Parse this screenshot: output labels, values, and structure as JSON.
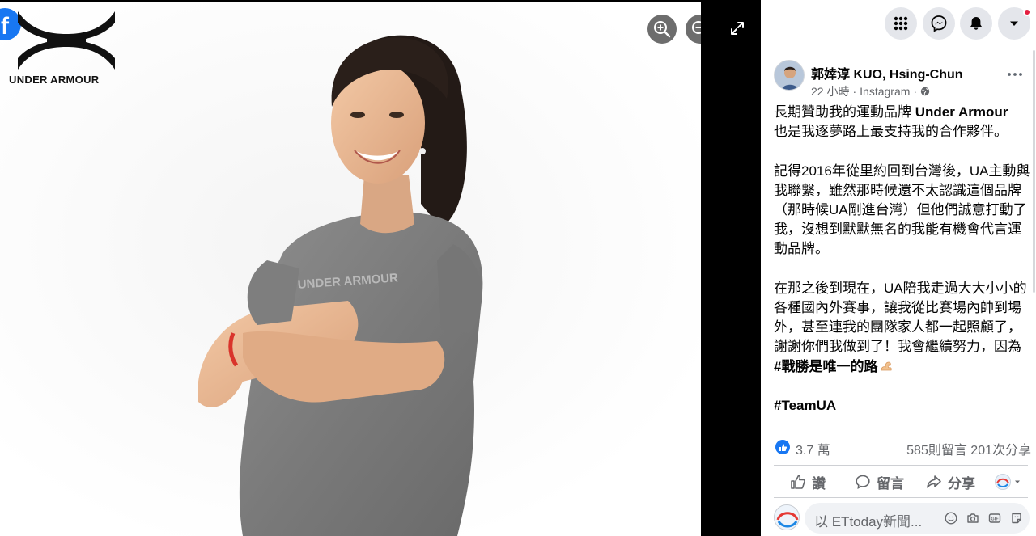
{
  "viewer": {
    "facebook_badge": "f",
    "brand_wordmark": "UNDER ARMOUR",
    "shirt_print": "UNDER ARMOUR",
    "icons": [
      "zoom-in-icon",
      "zoom-out-icon",
      "expand-icon"
    ]
  },
  "topbar": {
    "icons": [
      "menu-grid-icon",
      "messenger-icon",
      "bell-icon",
      "account-caret-icon"
    ],
    "colors": {
      "button_bg": "#e4e6eb",
      "notification": "#e41e3f"
    }
  },
  "post": {
    "author": "郭婞淳 KUO, Hsing-Chun",
    "time": "22 小時",
    "source": "Instagram",
    "separator": "·",
    "body": {
      "p1_text": "長期贊助我的運動品牌 ",
      "p1_bold": "Under Armour",
      "p1_rest": "也是我逐夢路上最支持我的合作夥伴。",
      "p2": "記得2016年從里約回到台灣後，UA主動與我聯繫，雖然那時候還不太認識這個品牌（那時候UA剛進台灣）但他們誠意打動了我，沒想到默默無名的我能有機會代言運動品牌。",
      "p3_text": "在那之後到現在，UA陪我走過大大小小的各種國內外賽事，讓我從比賽場內帥到場外，甚至連我的團隊家人都一起照顧了，謝謝你們我做到了！我會繼續努力，因為 ",
      "p3_bold": "#戰勝是唯一的路",
      "hashtag": "#TeamUA"
    },
    "reactions": {
      "likes": "3.7 萬",
      "comments": "585則留言",
      "shares": "201次分享"
    },
    "actions": {
      "like": "讚",
      "comment": "留言",
      "share": "分享"
    },
    "comment_box": {
      "placeholder": "以 ETtoday新聞..."
    },
    "colors": {
      "accent": "#1877f2",
      "text": "#050505",
      "muted": "#65676b"
    }
  }
}
